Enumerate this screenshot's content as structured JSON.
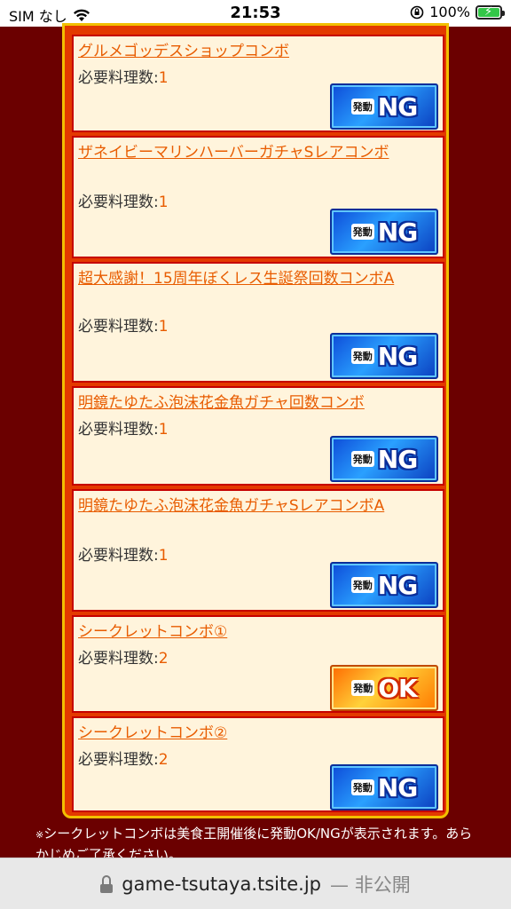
{
  "status_bar": {
    "carrier": "SIM なし",
    "time": "21:53",
    "battery_percent": "100%"
  },
  "combos": [
    {
      "title": "グルメゴッデスショップコンボ",
      "req_label": "必要料理数:",
      "req_value": "1",
      "status": "NG"
    },
    {
      "title": "ザネイビーマリンハーバーガチャSレアコンボ",
      "req_label": "必要料理数:",
      "req_value": "1",
      "status": "NG"
    },
    {
      "title": "超大感謝！15周年ぼくレス生誕祭回数コンボA",
      "req_label": "必要料理数:",
      "req_value": "1",
      "status": "NG"
    },
    {
      "title": "明鏡たゆたふ泡沫花金魚ガチャ回数コンボ",
      "req_label": "必要料理数:",
      "req_value": "1",
      "status": "NG"
    },
    {
      "title": "明鏡たゆたふ泡沫花金魚ガチャSレアコンボA",
      "req_label": "必要料理数:",
      "req_value": "1",
      "status": "NG"
    },
    {
      "title": "シークレットコンボ①",
      "req_label": "必要料理数:",
      "req_value": "2",
      "status": "OK"
    },
    {
      "title": "シークレットコンボ②",
      "req_label": "必要料理数:",
      "req_value": "2",
      "status": "NG"
    }
  ],
  "button_small_label": "発動",
  "note": {
    "mark": "※",
    "text": "シークレットコンボは美食王開催後に発動OK/NGが表示されます。あらかじめご了承ください。"
  },
  "url_bar": {
    "url": "game-tsutaya.tsite.jp",
    "suffix": "— 非公開"
  },
  "colors": {
    "background": "#6b0000",
    "frame_border": "#f2c000",
    "card_bg": "#fff4dc",
    "link": "#e85c00",
    "ng_button": "#1a6de8",
    "ok_button": "#ff9a00"
  }
}
